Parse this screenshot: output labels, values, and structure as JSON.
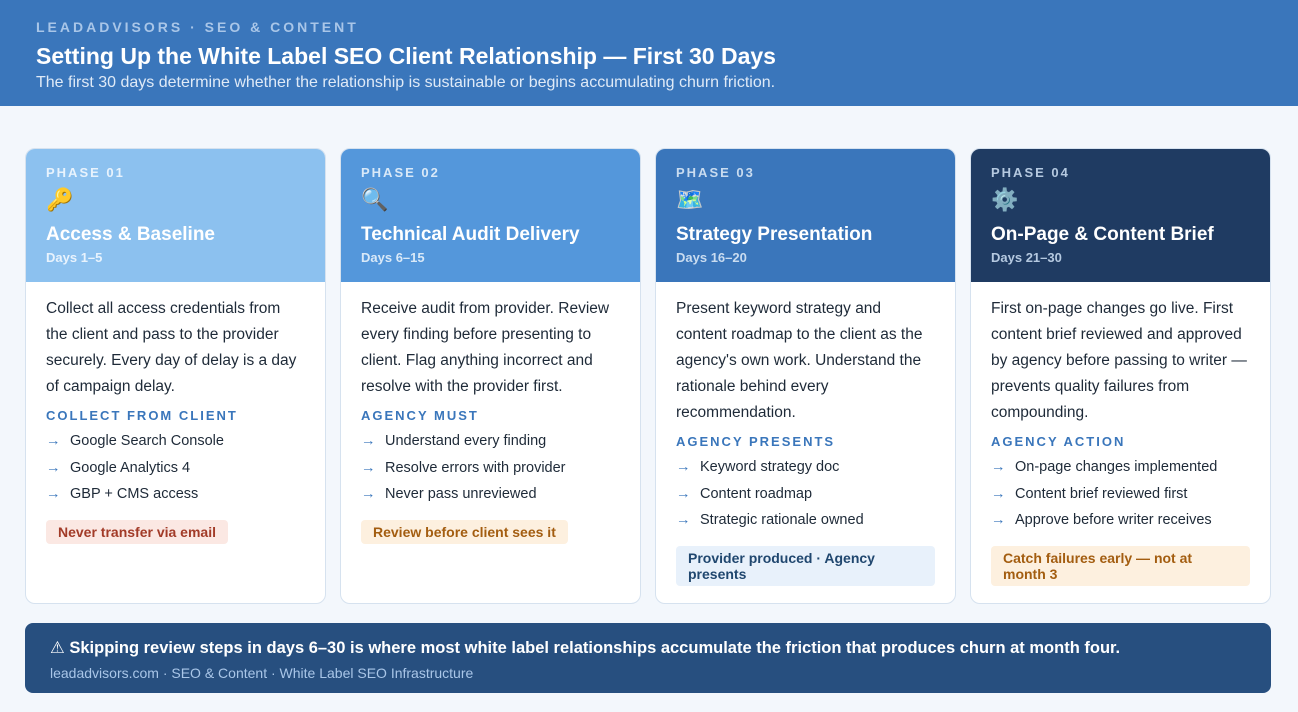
{
  "header": {
    "eyebrow": "LEADADVISORS · SEO & CONTENT",
    "title": "Setting Up the White Label SEO Client Relationship — First 30 Days",
    "subtitle": "The first 30 days determine whether the relationship is sustainable or begins accumulating churn friction."
  },
  "phases": [
    {
      "label": "PHASE 01",
      "icon": "🔑",
      "icon_name": "key-icon",
      "title": "Access & Baseline",
      "days": "Days 1–5",
      "description": "Collect all access credentials from the client and pass to the provider securely. Every day of delay is a day of campaign delay.",
      "sub_heading": "COLLECT FROM CLIENT",
      "items": [
        "Google Search Console",
        "Google Analytics 4",
        "GBP + CMS access"
      ],
      "tag": "Never transfer via email",
      "colors": {
        "head_bg": "#8cc1ef",
        "label": "#e8f3fd",
        "days": "#e8f3fd"
      }
    },
    {
      "label": "PHASE 02",
      "icon": "🔍",
      "icon_name": "magnifier-icon",
      "title": "Technical Audit Delivery",
      "days": "Days 6–15",
      "description": "Receive audit from provider. Review every finding before presenting to client. Flag anything incorrect and resolve with the provider first.",
      "sub_heading": "AGENCY MUST",
      "items": [
        "Understand every finding",
        "Resolve errors with provider",
        "Never pass unreviewed"
      ],
      "tag": "Review before client sees it",
      "colors": {
        "head_bg": "#5497db",
        "label": "#d9e9f8",
        "days": "#d9e9f8"
      }
    },
    {
      "label": "PHASE 03",
      "icon": "🗺️",
      "icon_name": "map-icon",
      "title": "Strategy Presentation",
      "days": "Days 16–20",
      "description": "Present keyword strategy and content roadmap to the client as the agency's own work. Understand the rationale behind every recommendation.",
      "sub_heading": "AGENCY PRESENTS",
      "items": [
        "Keyword strategy doc",
        "Content roadmap",
        "Strategic rationale owned"
      ],
      "tag": "Provider produced · Agency presents",
      "colors": {
        "head_bg": "#3a76bb",
        "label": "#c9dcf0",
        "days": "#c9dcf0"
      }
    },
    {
      "label": "PHASE 04",
      "icon": "⚙️",
      "icon_name": "gear-icon",
      "title": "On-Page & Content Brief",
      "days": "Days 21–30",
      "description": "First on-page changes go live. First content brief reviewed and approved by agency before passing to writer — prevents quality failures from compounding.",
      "sub_heading": "AGENCY ACTION",
      "items": [
        "On-page changes implemented",
        "Content brief reviewed first",
        "Approve before writer receives"
      ],
      "tag": "Catch failures early — not at month 3",
      "colors": {
        "head_bg": "#1f3b62",
        "label": "#b5c9e0",
        "days": "#b5c9e0"
      }
    }
  ],
  "footer": {
    "main": "⚠ Skipping review steps in days 6–30 is where most white label relationships accumulate the friction that produces churn at month four.",
    "sub": "leadadvisors.com · SEO & Content · White Label SEO Infrastructure"
  }
}
